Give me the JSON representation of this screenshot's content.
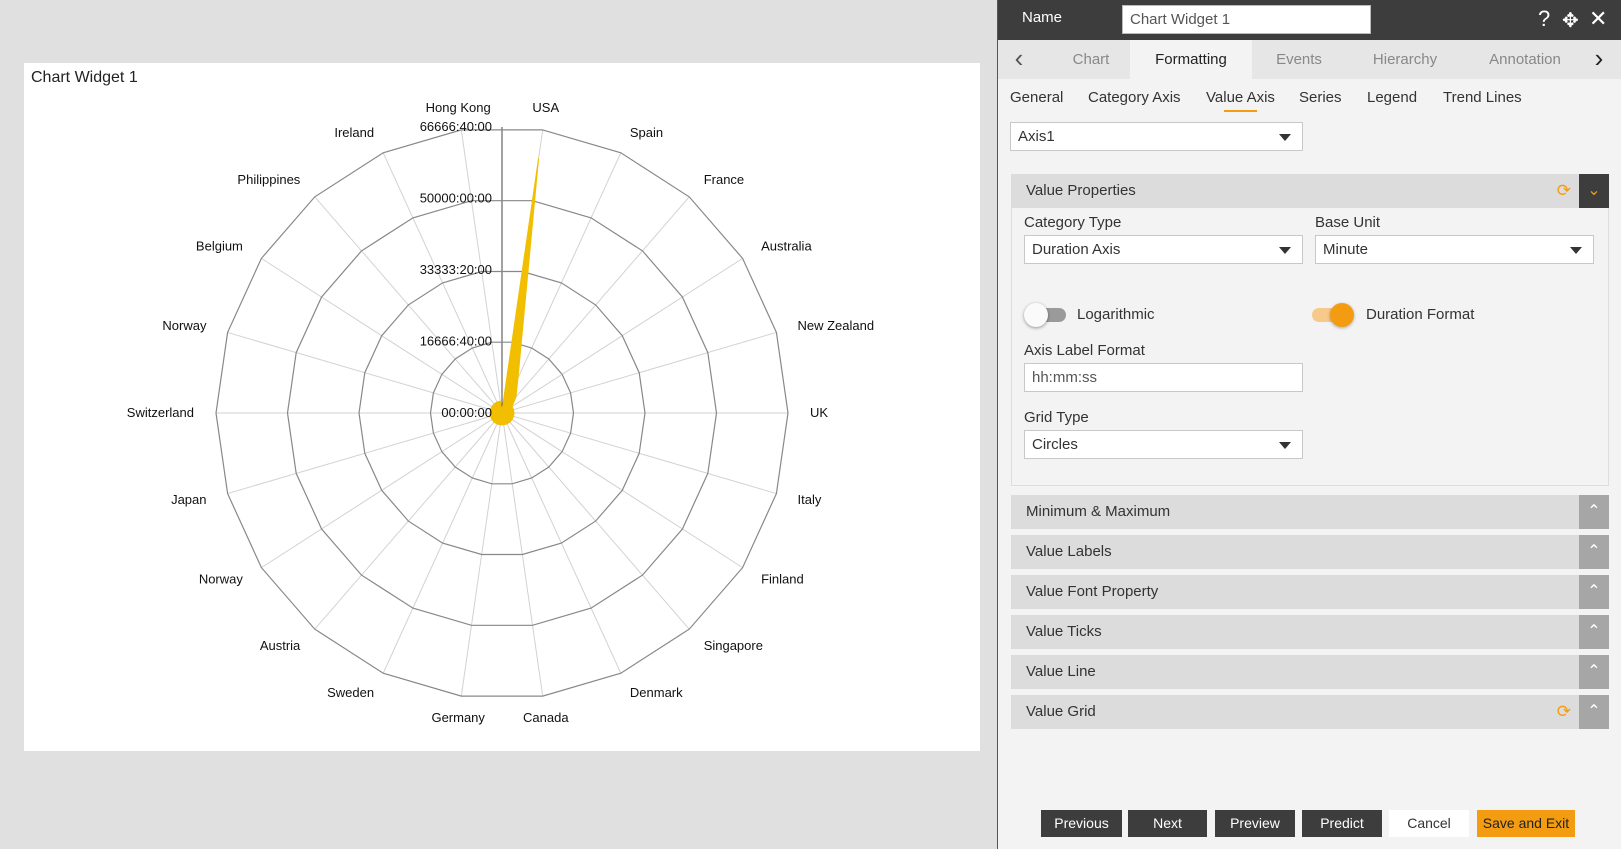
{
  "widget": {
    "title": "Chart Widget 1"
  },
  "chart_data": {
    "type": "radar",
    "categories": [
      "USA",
      "Spain",
      "France",
      "Australia",
      "New Zealand",
      "UK",
      "Italy",
      "Finland",
      "Singapore",
      "Denmark",
      "Canada",
      "Germany",
      "Sweden",
      "Austria",
      "Norway",
      "Japan",
      "Switzerland",
      "Norway",
      "Belgium",
      "Philippines",
      "Ireland",
      "Hong Kong"
    ],
    "tick_labels": [
      "00:00:00",
      "16666:40:00",
      "33333:20:00",
      "50000:00:00",
      "66666:40:00"
    ],
    "values": [
      60000,
      9000,
      5000,
      2500,
      1800,
      1000,
      600,
      400,
      300,
      200,
      150,
      100,
      80,
      60,
      50,
      40,
      30,
      25,
      20,
      15,
      12,
      10
    ],
    "rmax": 66666.67,
    "grid": "circles",
    "series_color": "#f2be00"
  },
  "panel": {
    "name_label": "Name",
    "name_value": "Chart Widget 1",
    "tabs": [
      "Chart",
      "Formatting",
      "Events",
      "Hierarchy",
      "Annotation"
    ],
    "subtabs": [
      "General",
      "Category Axis",
      "Value Axis",
      "Series",
      "Legend",
      "Trend Lines"
    ],
    "axis_select": "Axis1",
    "value_properties": {
      "title": "Value Properties",
      "category_type_label": "Category Type",
      "category_type_value": "Duration Axis",
      "base_unit_label": "Base Unit",
      "base_unit_value": "Minute",
      "logarithmic_label": "Logarithmic",
      "duration_format_label": "Duration Format",
      "axis_label_format_label": "Axis Label Format",
      "axis_label_format_value": "hh:mm:ss",
      "grid_type_label": "Grid Type",
      "grid_type_value": "Circles"
    },
    "sections": [
      "Minimum & Maximum",
      "Value Labels",
      "Value Font Property",
      "Value Ticks",
      "Value Line",
      "Value Grid"
    ],
    "footer": {
      "previous": "Previous",
      "next": "Next",
      "preview": "Preview",
      "predict": "Predict",
      "cancel": "Cancel",
      "save_exit": "Save and Exit"
    }
  }
}
